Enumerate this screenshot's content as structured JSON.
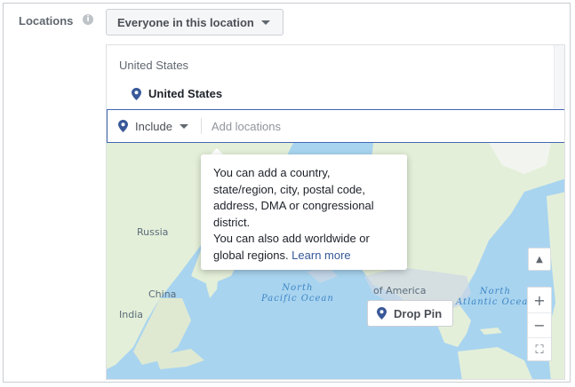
{
  "locations": {
    "label": "Locations",
    "info_glyph": "i",
    "audience_dropdown": "Everyone in this location",
    "group_label": "United States",
    "selected": [
      {
        "name": "United States",
        "icon": "location-pin-icon"
      }
    ],
    "include_label": "Include",
    "search_placeholder": "Add locations"
  },
  "map": {
    "labels": {
      "russia": "Russia",
      "china": "China",
      "india": "India",
      "north_pacific": "North\nPacific Ocean",
      "north_atlantic": "North\nAtlantic Ocean",
      "america": "of America"
    },
    "controls": {
      "up": "▲",
      "zoom_in": "+",
      "zoom_out": "−",
      "locate": "⛶"
    },
    "drop_pin_label": "Drop Pin"
  },
  "tooltip": {
    "text": "You can add a country, state/region, city, postal code, address, DMA or congressional district.\nYou can also add worldwide or global regions.",
    "link": "Learn more"
  },
  "colors": {
    "accent": "#4267b2",
    "pin": "#385898",
    "ocean": "#a8d4f0",
    "land": "#e4efd9"
  }
}
